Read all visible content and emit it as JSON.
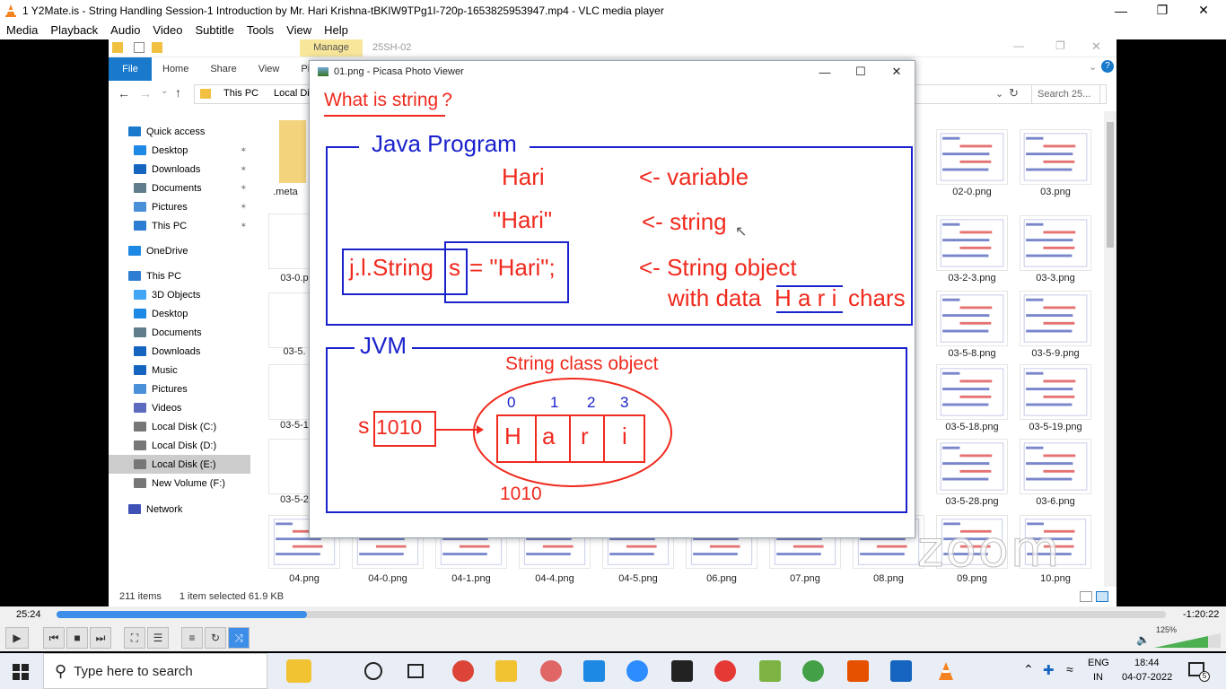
{
  "vlc": {
    "title": "1 Y2Mate.is - String Handling Session-1 Introduction  by Mr. Hari Krishna-tBKIW9TPg1I-720p-1653825953947.mp4 - VLC media player",
    "menu": [
      "Media",
      "Playback",
      "Audio",
      "Video",
      "Subtitle",
      "Tools",
      "View",
      "Help"
    ],
    "time_elapsed": "25:24",
    "time_remaining": "-1:20:22",
    "progress_fraction": 0.226,
    "volume": "125%"
  },
  "explorer": {
    "manage_tab": "Manage",
    "context_title": "25SH-02",
    "tabs": [
      "File",
      "Home",
      "Share",
      "View",
      "Pi"
    ],
    "breadcrumb": [
      "This PC",
      "Local Dis"
    ],
    "search_placeholder": "Search 25...",
    "nav": [
      {
        "label": "Quick access",
        "icon": "star-icon"
      },
      {
        "label": "Desktop",
        "icon": "desktop-icon",
        "pinned": true
      },
      {
        "label": "Downloads",
        "icon": "download-icon",
        "pinned": true
      },
      {
        "label": "Documents",
        "icon": "documents-icon",
        "pinned": true
      },
      {
        "label": "Pictures",
        "icon": "pictures-icon",
        "pinned": true
      },
      {
        "label": "This PC",
        "icon": "pc-icon",
        "pinned": true
      },
      {
        "label": "OneDrive",
        "icon": "cloud-icon"
      },
      {
        "label": "This PC",
        "icon": "pc-icon"
      },
      {
        "label": "3D Objects",
        "icon": "cube-icon"
      },
      {
        "label": "Desktop",
        "icon": "desktop-icon"
      },
      {
        "label": "Documents",
        "icon": "documents-icon"
      },
      {
        "label": "Downloads",
        "icon": "download-icon"
      },
      {
        "label": "Music",
        "icon": "music-icon"
      },
      {
        "label": "Pictures",
        "icon": "pictures-icon"
      },
      {
        "label": "Videos",
        "icon": "videos-icon"
      },
      {
        "label": "Local Disk (C:)",
        "icon": "disk-icon"
      },
      {
        "label": "Local Disk (D:)",
        "icon": "disk-icon"
      },
      {
        "label": "Local Disk (E:)",
        "icon": "disk-icon",
        "selected": true
      },
      {
        "label": "New Volume (F:)",
        "icon": "disk-icon"
      },
      {
        "label": "Network",
        "icon": "network-icon"
      }
    ],
    "left_labels": [
      ".meta",
      "03-0.p",
      "03-5.",
      "03-5-1",
      "03-5-2"
    ],
    "right_files": [
      [
        "02-0.png",
        "03.png"
      ],
      [
        "03-2-3.png",
        "03-3.png"
      ],
      [
        "03-5-8.png",
        "03-5-9.png"
      ],
      [
        "03-5-18.png",
        "03-5-19.png"
      ],
      [
        "03-5-28.png",
        "03-6.png"
      ]
    ],
    "bottom_files": [
      "04.png",
      "04-0.png",
      "04-1.png",
      "04-4.png",
      "04-5.png",
      "06.png",
      "07.png",
      "08.png",
      "09.png",
      "10.png"
    ],
    "status_items": "211 items",
    "status_selected": "1 item selected  61.9 KB"
  },
  "picasa": {
    "title": "01.png - Picasa Photo Viewer",
    "slide": {
      "heading": "What is string",
      "heading_q": "?",
      "java_label": "Java Program",
      "hari": "Hari",
      "variable_note": "<- variable",
      "hari_quoted": "\"Hari\"",
      "string_note": "<- string",
      "code_prefix": "j.l.String",
      "code_var": "s",
      "code_suffix": "= \"Hari\";",
      "object_note": "<- String object",
      "data_note": "with data",
      "chars": "H a r i",
      "chars_word": "chars",
      "jvm_label": "JVM",
      "class_object": "String class object",
      "ref_var": "s",
      "ref_value": "1010",
      "indices": [
        "0",
        "1",
        "2",
        "3"
      ],
      "letters": [
        "H",
        "a",
        "r",
        "i"
      ],
      "address": "1010"
    }
  },
  "watermark": "zoom",
  "taskbar": {
    "search": "Type here to search",
    "lang": "ENG",
    "region": "IN",
    "time": "18:44",
    "date": "04-07-2022",
    "notifications": "5"
  }
}
